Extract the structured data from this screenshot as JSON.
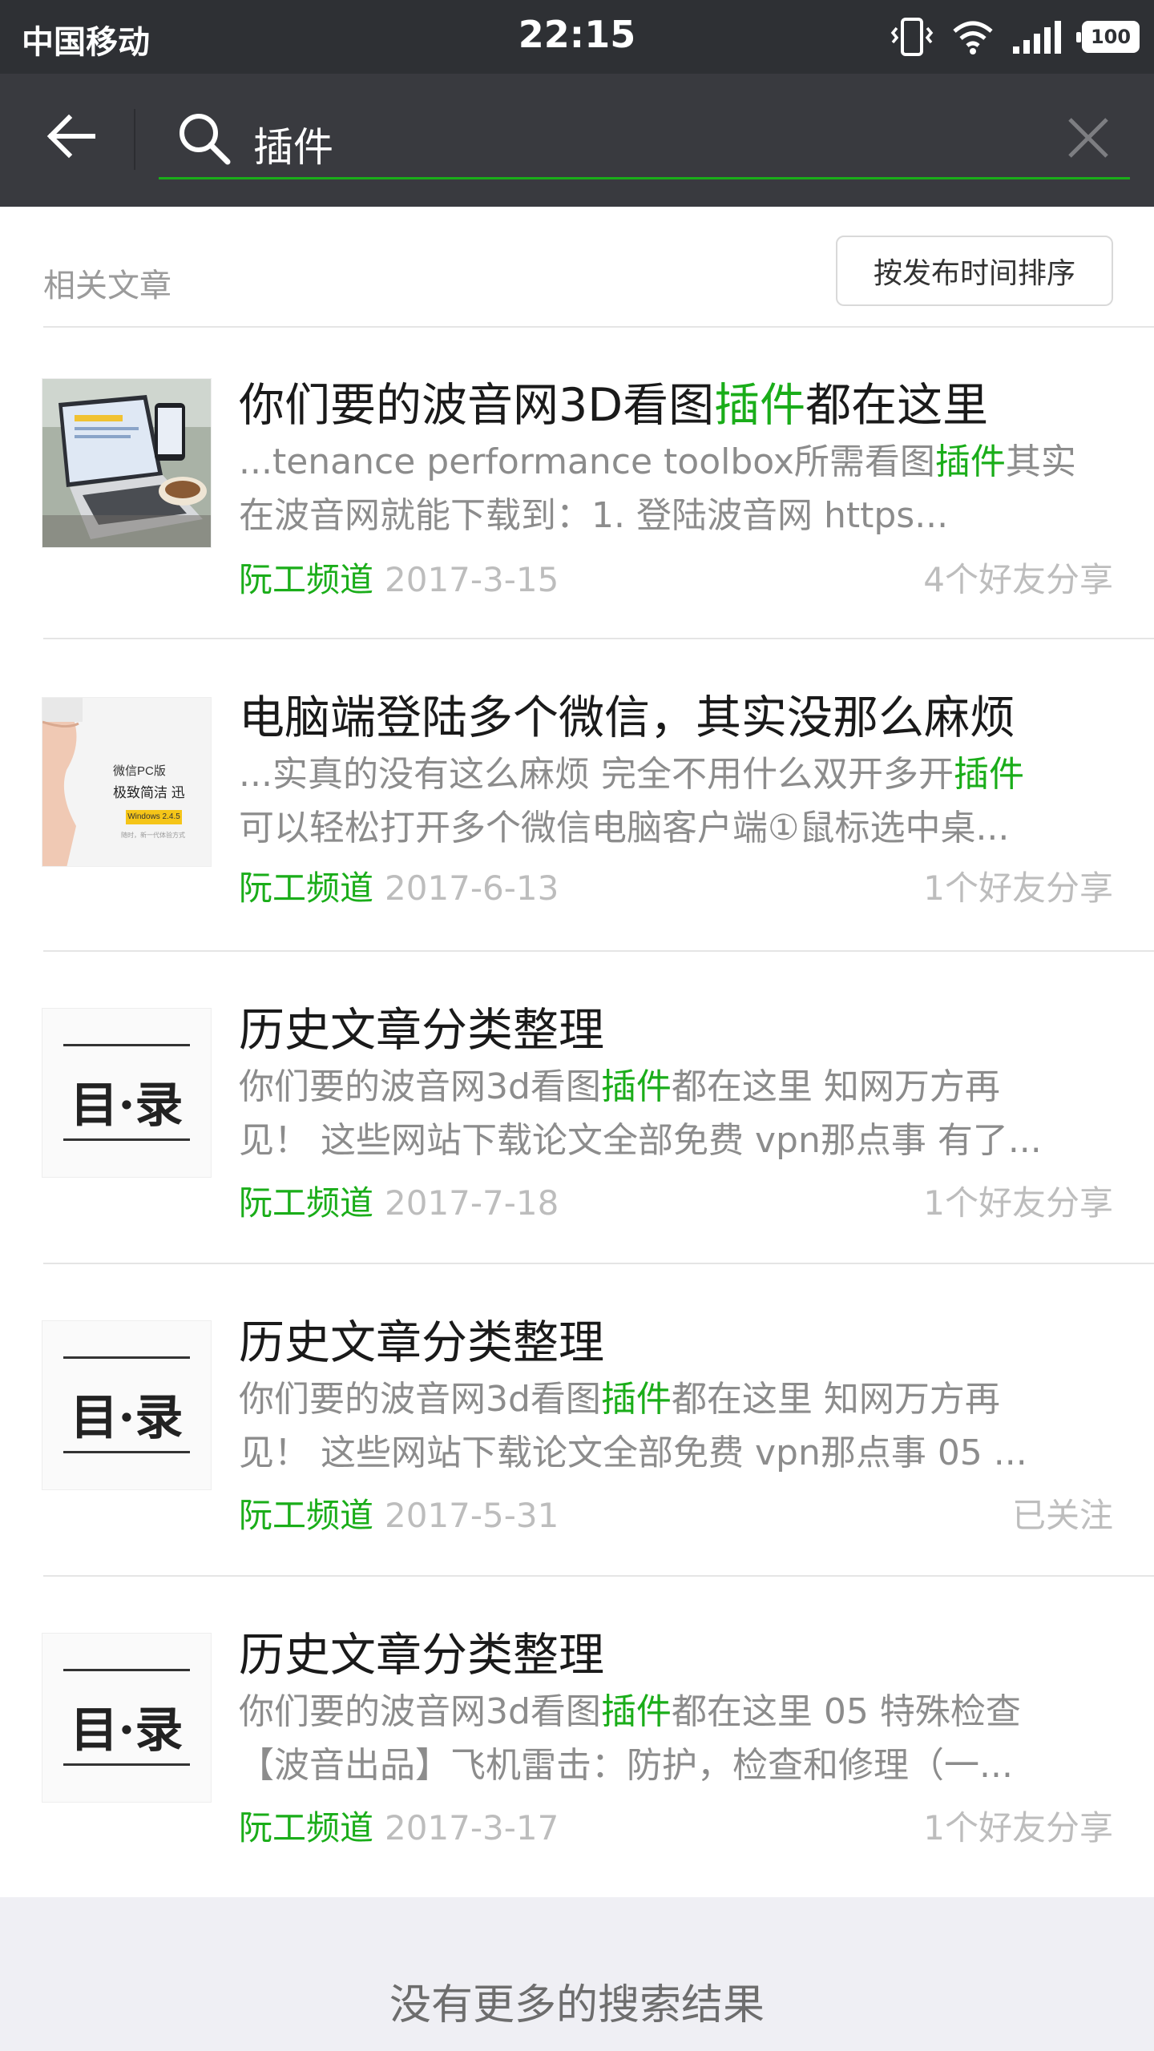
{
  "status_bar": {
    "carrier": "中国移动",
    "time": "22:15",
    "battery": "100"
  },
  "search": {
    "query": "插件"
  },
  "section": {
    "title": "相关文章",
    "sort_label": "按发布时间排序"
  },
  "articles": [
    {
      "title_pre": "你们要的波音网3D看图",
      "title_hl": "插件",
      "title_post": "都在这里",
      "line1_pre": "...tenance performance toolbox所需看图",
      "line1_hl": "插件",
      "line1_post": "其实",
      "line2": "在波音网就能下载到：1. 登陆波音网 https...",
      "source": "阮工频道",
      "date": "2017-3-15",
      "share": "4个好友分享",
      "thumb": "laptop-photo"
    },
    {
      "title": "电脑端登陆多个微信，其实没那么麻烦",
      "line1_pre": "...实真的没有这么麻烦 完全不用什么双开多开",
      "line1_hl": "插件",
      "line2": "可以轻松打开多个微信电脑客户端①鼠标选中桌...",
      "source": "阮工频道",
      "date": "2017-6-13",
      "share": "1个好友分享",
      "thumb": "wechat-pc-promo",
      "thumb_text": {
        "line1": "微信PC版",
        "line2": "极致简洁 迅",
        "badge": "Windows 2.4.5",
        "small": "随时，新一代体验方式"
      }
    },
    {
      "title": "历史文章分类整理",
      "line1_pre": "你们要的波音网3d看图",
      "line1_hl": "插件",
      "line1_post": "都在这里 知网万方再",
      "line2": "见！ 这些网站下载论文全部免费 vpn那点事 有了...",
      "source": "阮工频道",
      "date": "2017-7-18",
      "share": "1个好友分享",
      "thumb_text": "目·录"
    },
    {
      "title": "历史文章分类整理",
      "line1_pre": "你们要的波音网3d看图",
      "line1_hl": "插件",
      "line1_post": "都在这里 知网万方再",
      "line2": "见！ 这些网站下载论文全部免费 vpn那点事 05 ...",
      "source": "阮工频道",
      "date": "2017-5-31",
      "share": "已关注",
      "thumb_text": "目·录"
    },
    {
      "title": "历史文章分类整理",
      "line1_pre": "你们要的波音网3d看图",
      "line1_hl": "插件",
      "line1_post": "都在这里 05 特殊检查",
      "line2": "【波音出品】飞机雷击：防护，检查和修理（一...",
      "source": "阮工频道",
      "date": "2017-3-17",
      "share": "1个好友分享",
      "thumb_text": "目·录"
    }
  ],
  "footer": {
    "text": "没有更多的搜索结果"
  },
  "colors": {
    "accent": "#1aad19",
    "header_bg": "#393a3f",
    "status_bg": "#2e3034"
  }
}
